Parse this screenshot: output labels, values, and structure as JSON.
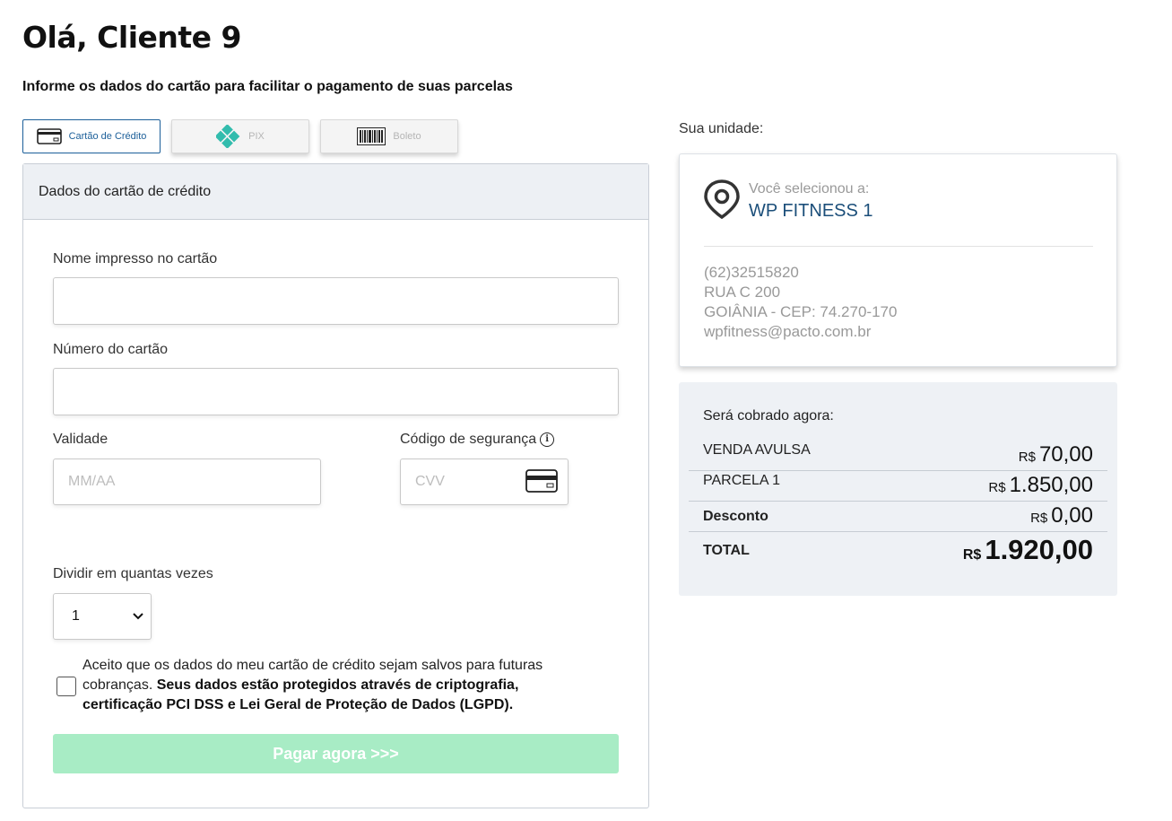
{
  "header": {
    "greeting": "Olá, Cliente 9",
    "subtitle": "Informe os dados do cartão para facilitar o pagamento de suas parcelas"
  },
  "payment_tabs": [
    {
      "label": "Cartão de Crédito",
      "icon": "credit-card-icon",
      "active": true
    },
    {
      "label": "PIX",
      "icon": "pix-icon",
      "active": false
    },
    {
      "label": "Boleto",
      "icon": "barcode-icon",
      "active": false
    }
  ],
  "form": {
    "title": "Dados do cartão de crédito",
    "name_label": "Nome impresso no cartão",
    "name_value": "",
    "number_label": "Número do cartão",
    "number_value": "",
    "expiry_label": "Validade",
    "expiry_placeholder": "MM/AA",
    "cvv_label": "Código de segurança",
    "cvv_placeholder": "CVV",
    "installments_label": "Dividir em quantas vezes",
    "installments_value": "1",
    "consent_text": "Aceito que os dados do meu cartão de crédito sejam salvos para futuras cobranças.",
    "consent_bold": "Seus dados estão protegidos através de criptografia, certificação PCI DSS e Lei Geral de Proteção de Dados (LGPD).",
    "consent_checked": false,
    "pay_button": "Pagar agora >>>",
    "pay_button_color": "#a8ecc5"
  },
  "unit": {
    "section_label": "Sua unidade:",
    "selected_label": "Você selecionou a:",
    "name": "WP FITNESS 1",
    "phone": "(62)32515820",
    "address": "RUA C 200",
    "city": "GOIÂNIA - CEP: 74.270-170",
    "email": "wpfitness@pacto.com.br"
  },
  "summary": {
    "title": "Será cobrado agora:",
    "currency": "R$",
    "items": [
      {
        "name": "VENDA AVULSA",
        "value": "70,00"
      },
      {
        "name": "PARCELA 1",
        "value": "1.850,00"
      }
    ],
    "discount_label": "Desconto",
    "discount_value": "0,00",
    "total_label": "TOTAL",
    "total_value": "1.920,00"
  },
  "colors": {
    "accent": "#1c5f99",
    "unit_name": "#1c4f7a",
    "pix": "#32bcad"
  }
}
